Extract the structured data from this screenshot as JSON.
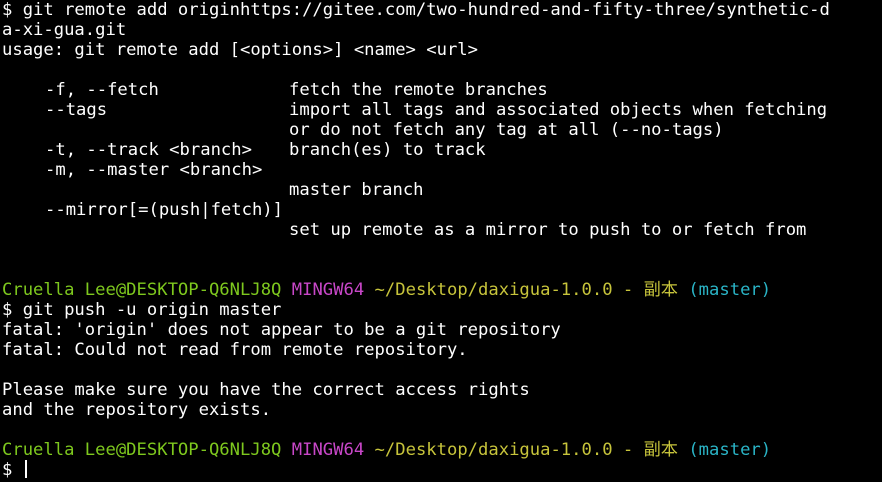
{
  "colors": {
    "background": "#000000",
    "text": "#ffffff",
    "user_host": "#7ec81e",
    "system": "#c847c8",
    "path": "#c7c43b",
    "branch": "#2ab4c6"
  },
  "block1": {
    "command_wrap1": "$ git remote add originhttps://gitee.com/two-hundred-and-fifty-three/synthetic-d",
    "command_wrap2": "a-xi-gua.git",
    "usage": "usage: git remote add [<options>] <name> <url>",
    "options": [
      {
        "name": "-f, --fetch",
        "desc": "fetch the remote branches"
      },
      {
        "name": "--tags",
        "desc": "import all tags and associated objects when fetching"
      },
      {
        "name": "",
        "desc": "or do not fetch any tag at all (--no-tags)"
      },
      {
        "name": "-t, --track <branch>",
        "desc": "branch(es) to track"
      },
      {
        "name": "-m, --master <branch>",
        "desc": ""
      },
      {
        "name": "",
        "desc": "master branch"
      },
      {
        "name": "--mirror[=(push|fetch)]",
        "desc": ""
      },
      {
        "name": "",
        "desc": "set up remote as a mirror to push to or fetch from"
      }
    ]
  },
  "prompt": {
    "user_host": "Cruella Lee@DESKTOP-Q6NLJ8Q",
    "system": "MINGW64",
    "path": "~/Desktop/daxigua-1.0.0 - 副本",
    "branch": "(master)"
  },
  "block2": {
    "command": "$ git push -u origin master",
    "error1": "fatal: 'origin' does not appear to be a git repository",
    "error2": "fatal: Could not read from remote repository.",
    "hint1": "Please make sure you have the correct access rights",
    "hint2": "and the repository exists."
  },
  "input": {
    "symbol": "$",
    "value": ""
  }
}
